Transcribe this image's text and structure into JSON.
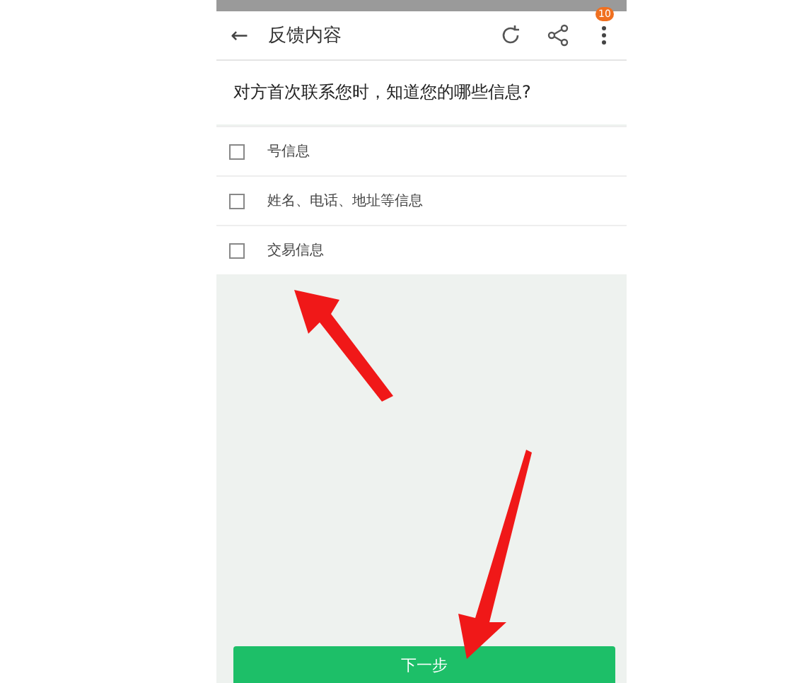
{
  "header": {
    "back": "←",
    "title": "反馈内容",
    "badge": "10"
  },
  "question": "对方首次联系您时，知道您的哪些信息?",
  "options": [
    {
      "label": "号信息",
      "checked": false
    },
    {
      "label": "姓名、电话、地址等信息",
      "checked": false
    },
    {
      "label": "交易信息",
      "checked": false
    }
  ],
  "next_button": "下一步"
}
